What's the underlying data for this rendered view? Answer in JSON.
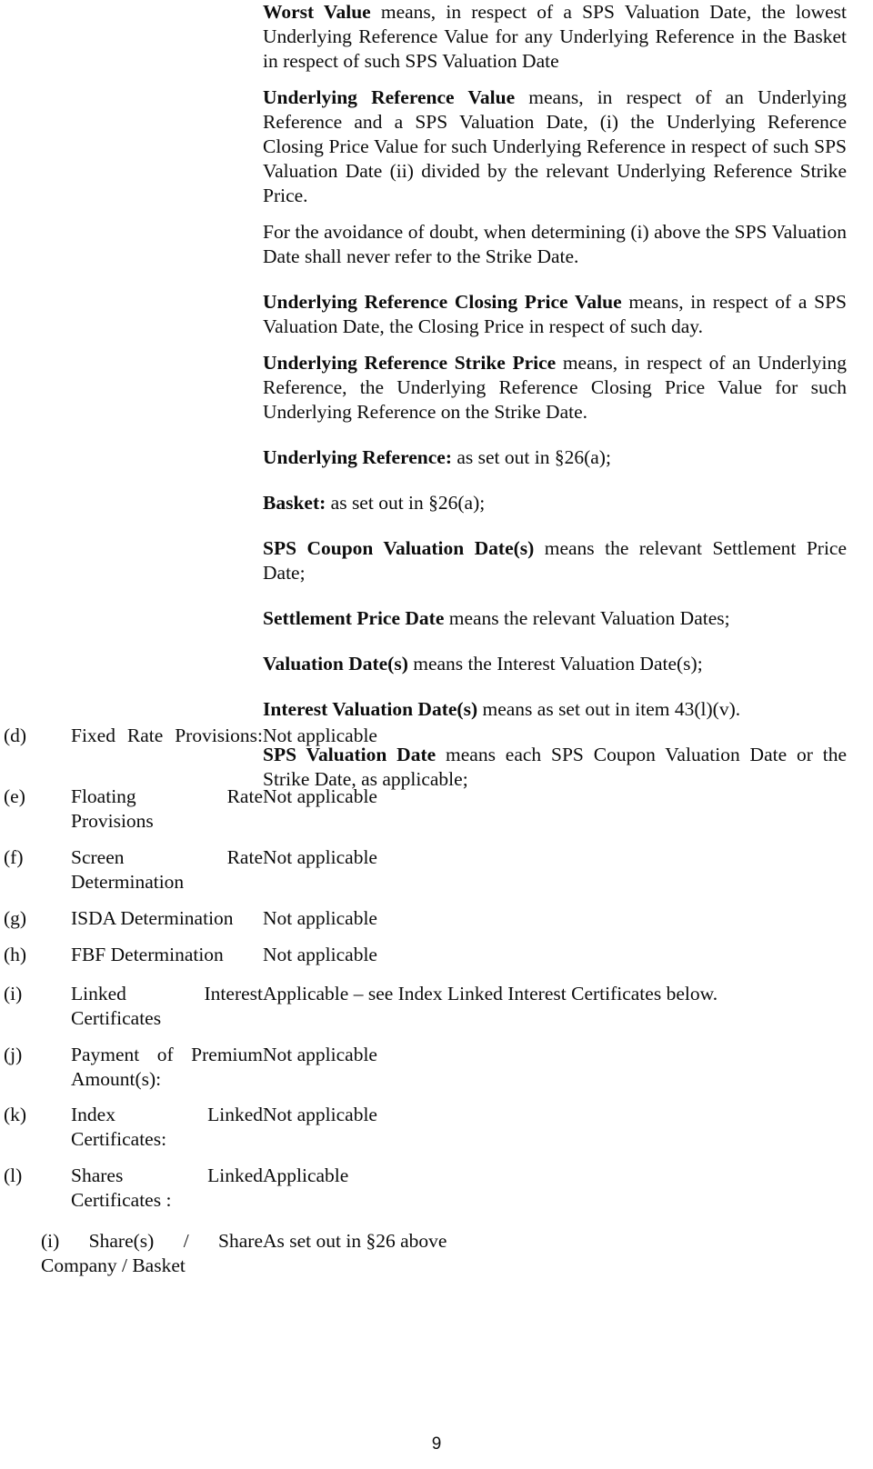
{
  "document": {
    "page_number": "9",
    "definitions": [
      {
        "term": "Worst Value",
        "body": " means, in respect of a SPS Valuation Date, the lowest Underlying Reference Value for any Underlying Reference in the Basket in respect of such SPS Valuation Date"
      },
      {
        "term": "Underlying Reference Value",
        "body": " means, in respect of an Underlying Reference and a SPS Valuation Date, (i) the Underlying Reference Closing Price Value for such Underlying Reference in respect of such SPS Valuation Date (ii) divided by the relevant Underlying Reference Strike Price."
      },
      {
        "term": "",
        "body": "For the avoidance of doubt, when determining (i) above the SPS Valuation Date shall never refer to the Strike Date."
      },
      {
        "term": "Underlying Reference Closing Price Value",
        "body": " means, in respect of a SPS Valuation Date, the Closing Price in respect of such day."
      },
      {
        "term": "Underlying Reference Strike Price",
        "body": " means, in respect of an Underlying Reference, the Underlying Reference Closing Price Value for such Underlying Reference on the Strike Date."
      },
      {
        "term": "Underlying Reference:",
        "body": " as set out in §26(a);"
      },
      {
        "term": "Basket:",
        "body": " as set out in §26(a);"
      },
      {
        "term": "SPS Coupon Valuation Date(s)",
        "body": " means the relevant Settlement Price Date;"
      },
      {
        "term": "Settlement Price Date",
        "body": " means the relevant Valuation Dates;"
      },
      {
        "term": "Valuation Date(s)",
        "body": " means the Interest Valuation Date(s);"
      },
      {
        "term": "Interest Valuation Date(s)",
        "body": " means as set out in item 43(l)(v)."
      },
      {
        "term": "SPS Valuation Date",
        "body": " means each SPS Coupon Valuation Date or the Strike Date, as applicable;"
      }
    ],
    "rows": [
      {
        "letter": "(d)",
        "label": "Fixed Rate Provisions:",
        "label_line1": "Fixed                 Rate",
        "label_line2": "Provisions:",
        "value": "Not applicable"
      },
      {
        "letter": "(e)",
        "label": "Floating Rate Provisions",
        "value": "Not applicable"
      },
      {
        "letter": "(f)",
        "label": "Screen Rate Determination",
        "value": "Not applicable"
      },
      {
        "letter": "(g)",
        "label": "ISDA Determination",
        "value": "Not applicable"
      },
      {
        "letter": "(h)",
        "label": "FBF Determination",
        "value": "Not applicable"
      },
      {
        "letter": "(i)",
        "label": "Linked Interest Certificates",
        "value": "Applicable – see Index Linked Interest Certificates below."
      },
      {
        "letter": "(j)",
        "label": "Payment of Premium Amount(s):",
        "value": "Not applicable"
      },
      {
        "letter": "(k)",
        "label": "Index Linked Certificates:",
        "value": "Not applicable"
      },
      {
        "letter": "(l)",
        "label": "Shares Linked Certificates :",
        "value": "Applicable"
      },
      {
        "letter": "",
        "label": "(i) Share(s) / Share Company / Basket",
        "value": "As set out in §26 above"
      }
    ]
  }
}
